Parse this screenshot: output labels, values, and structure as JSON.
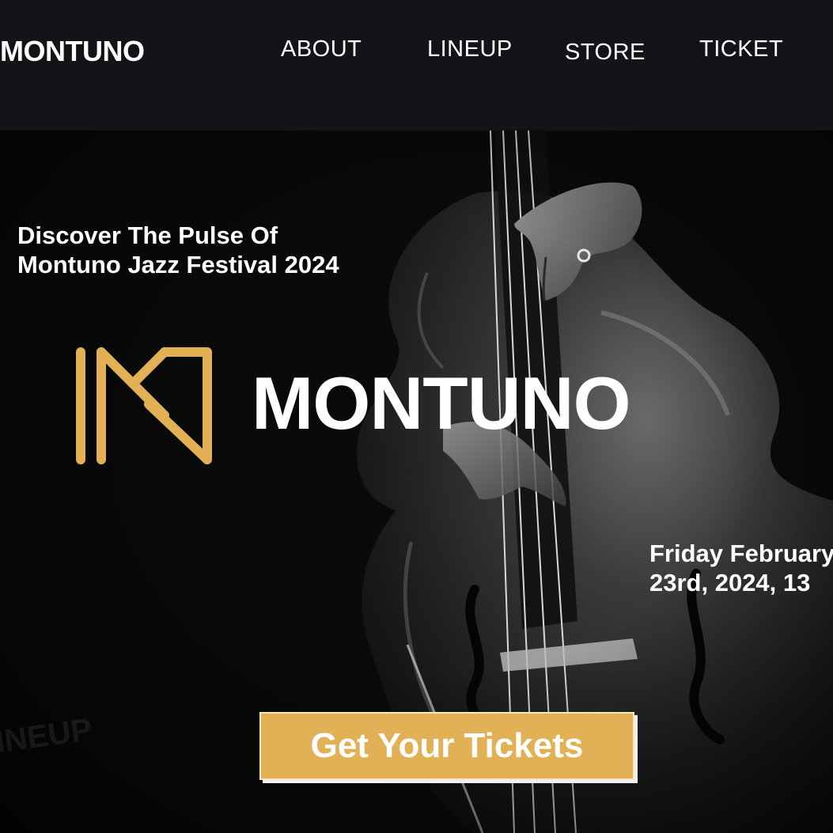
{
  "header": {
    "brand": "MONTUNO",
    "nav": [
      {
        "label": "ABOUT"
      },
      {
        "label": "LINEUP"
      },
      {
        "label": "STORE"
      },
      {
        "label": "TICKET"
      }
    ]
  },
  "hero": {
    "tagline_line1": "Discover The Pulse Of",
    "tagline_line2": "Montuno Jazz Festival 2024",
    "logo_word": "MONTUNO",
    "date_line1": "Friday February",
    "date_line2": "23rd, 2024, 13",
    "ghost_text": "LINEUP",
    "cta_label": "Get Your Tickets",
    "background_icon": "upright-bass-photo"
  },
  "colors": {
    "accent": "#e2b155",
    "background": "#0b0b0c",
    "header_bg": "#141418",
    "text": "#ffffff"
  }
}
